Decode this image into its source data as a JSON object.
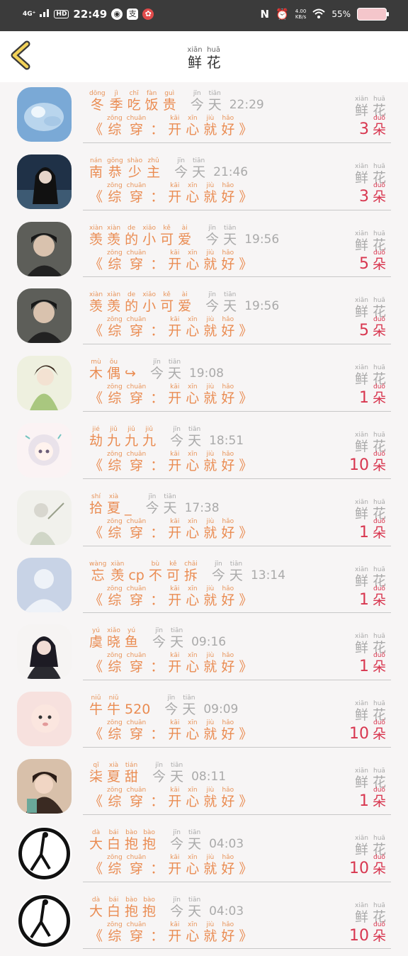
{
  "status_bar": {
    "network": "4G⁺",
    "hd": "HD",
    "time": "22:49",
    "app_icon_1": "支",
    "speed_value": "4.00",
    "speed_unit": "KB/s",
    "battery": "55%"
  },
  "header": {
    "title": [
      [
        "xiān",
        "鲜"
      ],
      [
        "huā",
        "花"
      ]
    ]
  },
  "rows": [
    {
      "avatar": "ice",
      "name": [
        [
          "dōng",
          "冬"
        ],
        [
          "jì",
          "季"
        ],
        [
          "chī",
          "吃"
        ],
        [
          "fàn",
          "饭"
        ],
        [
          "guì",
          "贵"
        ]
      ],
      "time": "22:29",
      "count": "3"
    },
    {
      "avatar": "girl-dark",
      "name": [
        [
          "nán",
          "南"
        ],
        [
          "gōng",
          "恭"
        ],
        [
          "shào",
          "少"
        ],
        [
          "zhǔ",
          "主"
        ]
      ],
      "time": "21:46",
      "count": "3"
    },
    {
      "avatar": "man",
      "name": [
        [
          "xiàn",
          "羡"
        ],
        [
          "xiàn",
          "羡"
        ],
        [
          "de",
          "的"
        ],
        [
          "xiǎo",
          "小"
        ],
        [
          "kě",
          "可"
        ],
        [
          "ài",
          "爱"
        ]
      ],
      "time": "19:56",
      "count": "5"
    },
    {
      "avatar": "man",
      "name": [
        [
          "xiàn",
          "羡"
        ],
        [
          "xiàn",
          "羡"
        ],
        [
          "de",
          "的"
        ],
        [
          "xiǎo",
          "小"
        ],
        [
          "kě",
          "可"
        ],
        [
          "ài",
          "爱"
        ]
      ],
      "time": "19:56",
      "count": "5"
    },
    {
      "avatar": "anime-girl",
      "name": [
        [
          "mù",
          "木"
        ],
        [
          "ǒu",
          "偶"
        ],
        [
          "",
          "↪"
        ]
      ],
      "time": "19:08",
      "count": "1"
    },
    {
      "avatar": "chibi",
      "name": [
        [
          "jié",
          "劫"
        ],
        [
          "jiǔ",
          "九"
        ],
        [
          "jiǔ",
          "九"
        ],
        [
          "jiǔ",
          "九"
        ]
      ],
      "time": "18:51",
      "count": "10"
    },
    {
      "avatar": "sketch",
      "name": [
        [
          "shí",
          "拾"
        ],
        [
          "xià",
          "夏"
        ],
        [
          "",
          "_"
        ]
      ],
      "time": "17:38",
      "count": "1"
    },
    {
      "avatar": "default",
      "name": [
        [
          "wàng",
          "忘"
        ],
        [
          "xiàn",
          "羡"
        ],
        [
          "",
          "cp"
        ],
        [
          "bù",
          "不"
        ],
        [
          "kě",
          "可"
        ],
        [
          "chāi",
          "拆"
        ]
      ],
      "time": "13:14",
      "count": "1"
    },
    {
      "avatar": "girl-hands",
      "name": [
        [
          "yú",
          "虞"
        ],
        [
          "xiǎo",
          "晓"
        ],
        [
          "yú",
          "鱼"
        ]
      ],
      "time": "09:16",
      "count": "1"
    },
    {
      "avatar": "baby",
      "name": [
        [
          "niǔ",
          "牛"
        ],
        [
          "niǔ",
          "牛"
        ],
        [
          "",
          "520"
        ]
      ],
      "time": "09:09",
      "count": "10"
    },
    {
      "avatar": "smile-girl",
      "name": [
        [
          "qī",
          "柒"
        ],
        [
          "xià",
          "夏"
        ],
        [
          "tián",
          "甜"
        ]
      ],
      "time": "08:11",
      "count": "1"
    },
    {
      "avatar": "silhouette",
      "name": [
        [
          "dà",
          "大"
        ],
        [
          "bái",
          "白"
        ],
        [
          "bào",
          "抱"
        ],
        [
          "bào",
          "抱"
        ]
      ],
      "time": "04:03",
      "count": "10"
    },
    {
      "avatar": "silhouette",
      "name": [
        [
          "dà",
          "大"
        ],
        [
          "bái",
          "白"
        ],
        [
          "bào",
          "抱"
        ],
        [
          "bào",
          "抱"
        ]
      ],
      "time": "04:03",
      "count": "10"
    }
  ],
  "today": [
    [
      "jīn",
      "今"
    ],
    [
      "tiān",
      "天"
    ]
  ],
  "subtitle": [
    [
      "",
      "《"
    ],
    [
      "zōng",
      "综"
    ],
    [
      "chuān",
      "穿"
    ],
    [
      "",
      "："
    ],
    [
      "kāi",
      "开"
    ],
    [
      "xīn",
      "心"
    ],
    [
      "jiù",
      "就"
    ],
    [
      "hǎo",
      "好"
    ],
    [
      "",
      "》"
    ]
  ],
  "flower": [
    [
      "xiān",
      "鲜"
    ],
    [
      "huā",
      "花"
    ]
  ],
  "unit": [
    [
      "duǒ",
      "朵"
    ]
  ]
}
